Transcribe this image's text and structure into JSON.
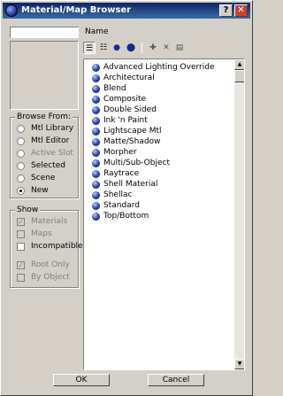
{
  "window": {
    "title": "Material/Map Browser",
    "help": "?",
    "close": "✕"
  },
  "search": {
    "value": "",
    "name_label": "Name"
  },
  "browse_from": {
    "title": "Browse From:",
    "options": [
      {
        "label": "Mtl Library",
        "checked": false,
        "enabled": true
      },
      {
        "label": "Mtl Editor",
        "checked": false,
        "enabled": true
      },
      {
        "label": "Active Slot",
        "checked": false,
        "enabled": false
      },
      {
        "label": "Selected",
        "checked": false,
        "enabled": true
      },
      {
        "label": "Scene",
        "checked": false,
        "enabled": true
      },
      {
        "label": "New",
        "checked": true,
        "enabled": true
      }
    ]
  },
  "show": {
    "title": "Show",
    "options": [
      {
        "label": "Materials",
        "checked": true,
        "enabled": false
      },
      {
        "label": "Maps",
        "checked": false,
        "enabled": false
      },
      {
        "label": "Incompatible",
        "checked": false,
        "enabled": true
      },
      {
        "label": "Root Only",
        "checked": true,
        "enabled": false
      },
      {
        "label": "By Object",
        "checked": false,
        "enabled": false
      }
    ]
  },
  "materials": [
    "Advanced Lighting Override",
    "Architectural",
    "Blend",
    "Composite",
    "Double Sided",
    "Ink 'n Paint",
    "Lightscape Mtl",
    "Matte/Shadow",
    "Morpher",
    "Multi/Sub-Object",
    "Raytrace",
    "Shell Material",
    "Shellac",
    "Standard",
    "Top/Bottom"
  ],
  "buttons": {
    "ok": "OK",
    "cancel": "Cancel"
  }
}
